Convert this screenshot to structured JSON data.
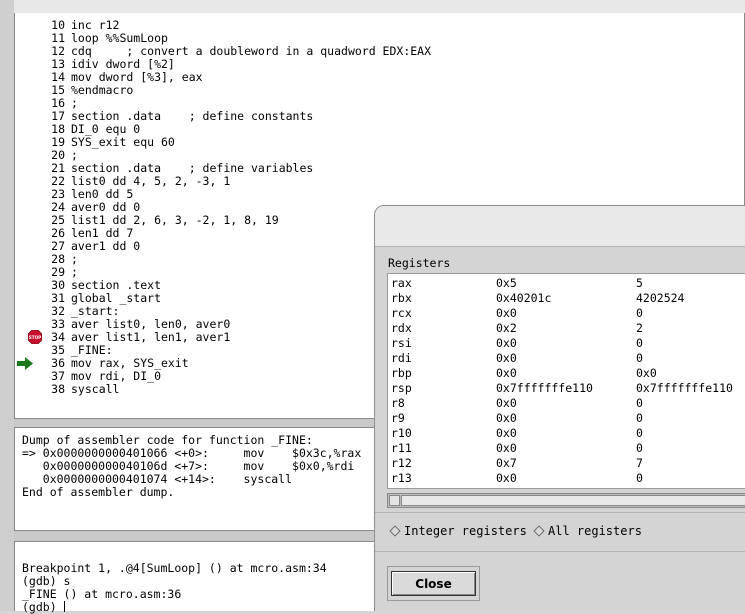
{
  "source": {
    "lines": [
      {
        "n": "10",
        "code": "inc r12"
      },
      {
        "n": "11",
        "code": "loop %%SumLoop"
      },
      {
        "n": "12",
        "code": "cdq     ; convert a doubleword in a quadword EDX:EAX"
      },
      {
        "n": "13",
        "code": "idiv dword [%2]"
      },
      {
        "n": "14",
        "code": "mov dword [%3], eax"
      },
      {
        "n": "15",
        "code": "%endmacro"
      },
      {
        "n": "16",
        "code": ";"
      },
      {
        "n": "17",
        "code": "section .data    ; define constants"
      },
      {
        "n": "18",
        "code": "DI_0 equ 0"
      },
      {
        "n": "19",
        "code": "SYS_exit equ 60"
      },
      {
        "n": "20",
        "code": ";"
      },
      {
        "n": "21",
        "code": "section .data    ; define variables"
      },
      {
        "n": "22",
        "code": "list0 dd 4, 5, 2, -3, 1"
      },
      {
        "n": "23",
        "code": "len0 dd 5"
      },
      {
        "n": "24",
        "code": "aver0 dd 0"
      },
      {
        "n": "25",
        "code": "list1 dd 2, 6, 3, -2, 1, 8, 19"
      },
      {
        "n": "26",
        "code": "len1 dd 7"
      },
      {
        "n": "27",
        "code": "aver1 dd 0"
      },
      {
        "n": "28",
        "code": ";"
      },
      {
        "n": "29",
        "code": ";"
      },
      {
        "n": "30",
        "code": "section .text"
      },
      {
        "n": "31",
        "code": "global _start"
      },
      {
        "n": "32",
        "code": "_start:"
      },
      {
        "n": "33",
        "code": "aver list0, len0, aver0"
      },
      {
        "n": "34",
        "code": "aver list1, len1, aver1"
      },
      {
        "n": "35",
        "code": "_FINE:"
      },
      {
        "n": "36",
        "code": "mov rax, SYS_exit"
      },
      {
        "n": "37",
        "code": "mov rdi, DI_0"
      },
      {
        "n": "38",
        "code": "syscall"
      }
    ],
    "breakpoint_line": "34",
    "current_line": "36"
  },
  "assembler": {
    "lines": [
      "Dump of assembler code for function _FINE:",
      "=> 0x0000000000401066 <+0>:     mov    $0x3c,%rax",
      "   0x000000000040106d <+7>:     mov    $0x0,%rdi",
      "   0x0000000000401074 <+14>:    syscall",
      "End of assembler dump."
    ]
  },
  "console": {
    "lines": [
      "Breakpoint 1, .@4[SumLoop] () at mcro.asm:34",
      "(gdb) s",
      "_FINE () at mcro.asm:36",
      "(gdb) "
    ]
  },
  "registers_window": {
    "label": "Registers",
    "rows": [
      {
        "name": "rax",
        "hex": "0x5",
        "natural": "5"
      },
      {
        "name": "rbx",
        "hex": "0x40201c",
        "natural": "4202524"
      },
      {
        "name": "rcx",
        "hex": "0x0",
        "natural": "0"
      },
      {
        "name": "rdx",
        "hex": "0x2",
        "natural": "2"
      },
      {
        "name": "rsi",
        "hex": "0x0",
        "natural": "0"
      },
      {
        "name": "rdi",
        "hex": "0x0",
        "natural": "0"
      },
      {
        "name": "rbp",
        "hex": "0x0",
        "natural": "0x0"
      },
      {
        "name": "rsp",
        "hex": "0x7fffffffe110",
        "natural": "0x7fffffffe110"
      },
      {
        "name": "r8",
        "hex": "0x0",
        "natural": "0"
      },
      {
        "name": "r9",
        "hex": "0x0",
        "natural": "0"
      },
      {
        "name": "r10",
        "hex": "0x0",
        "natural": "0"
      },
      {
        "name": "r11",
        "hex": "0x0",
        "natural": "0"
      },
      {
        "name": "r12",
        "hex": "0x7",
        "natural": "7"
      },
      {
        "name": "r13",
        "hex": "0x0",
        "natural": "0"
      }
    ],
    "radio_integer": "Integer registers",
    "radio_all": "All registers",
    "close_label": "Close"
  },
  "icons": {
    "breakpoint": "stop-sign-icon",
    "execution_pointer": "green-arrow-icon"
  },
  "colors": {
    "stop_sign": "#c8102e",
    "arrow": "#1a7a1a"
  }
}
